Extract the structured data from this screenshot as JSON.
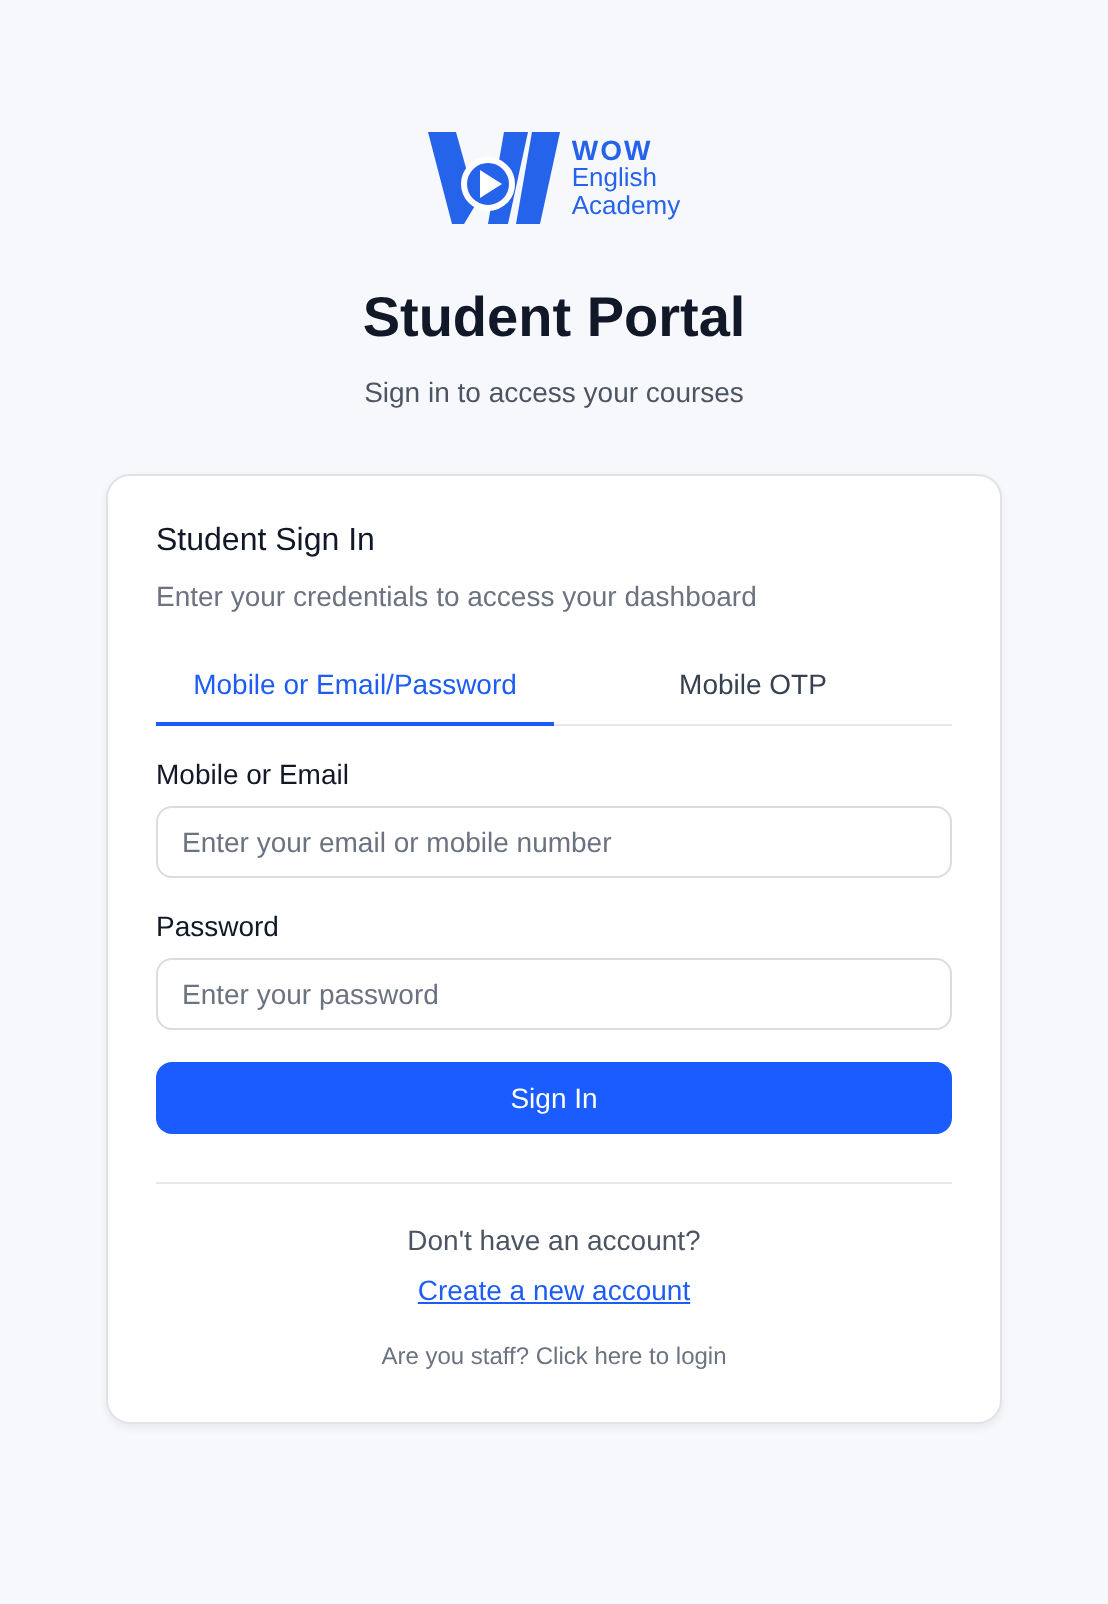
{
  "logo": {
    "lines": [
      "WOW",
      "English",
      "Academy"
    ]
  },
  "title": "Student Portal",
  "subtitle": "Sign in to access your courses",
  "card": {
    "title": "Student Sign In",
    "description": "Enter your credentials to access your dashboard",
    "tabs": [
      {
        "label": "Mobile or Email/Password",
        "selected": true
      },
      {
        "label": "Mobile OTP",
        "selected": false
      }
    ],
    "fields": [
      {
        "label": "Mobile or Email",
        "placeholder": "Enter your email or mobile number"
      },
      {
        "label": "Password",
        "placeholder": "Enter your password"
      }
    ],
    "submit": "Sign In",
    "signup_prompt": "Don't have an account?",
    "signup_link": "Create a new account",
    "staff_link": "Are you staff? Click here to login"
  }
}
